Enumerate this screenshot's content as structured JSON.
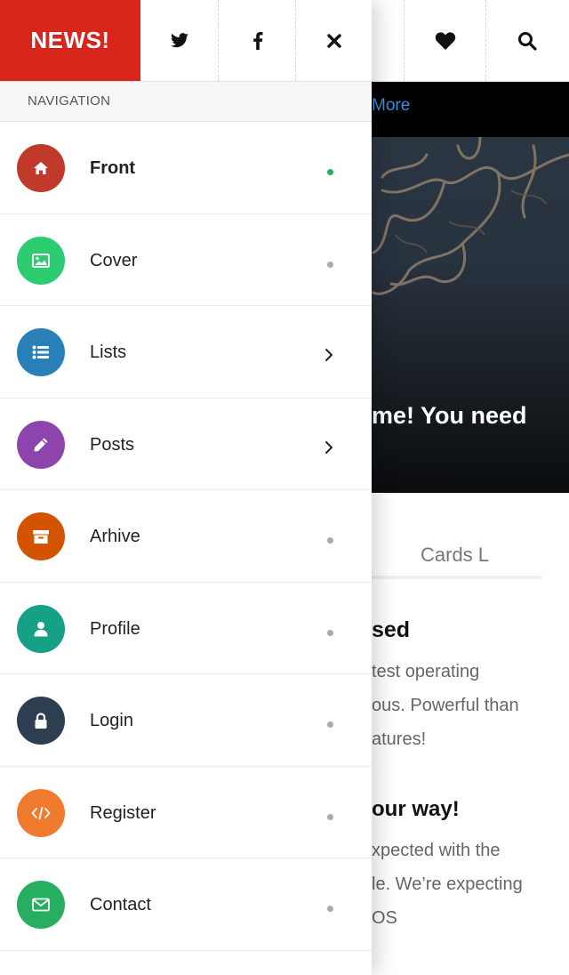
{
  "colors": {
    "brand_red": "#d9261c",
    "active_dot": "#27ae60",
    "inactive_dot": "#aaaaaa",
    "link_blue": "#3b8fd6"
  },
  "drawer": {
    "brand": "NEWS!",
    "social_icons": [
      "twitter-icon",
      "facebook-icon",
      "close-icon"
    ],
    "section_caption": "NAVIGATION",
    "items": [
      {
        "label": "Front",
        "icon": "home-icon",
        "color": "#c0392b",
        "indicator": "dot-active"
      },
      {
        "label": "Cover",
        "icon": "image-icon",
        "color": "#2ecc71",
        "indicator": "dot"
      },
      {
        "label": "Lists",
        "icon": "list-icon",
        "color": "#2980b9",
        "indicator": "chevron"
      },
      {
        "label": "Posts",
        "icon": "pencil-icon",
        "color": "#8e44ad",
        "indicator": "chevron"
      },
      {
        "label": "Arhive",
        "icon": "archive-icon",
        "color": "#d35400",
        "indicator": "dot"
      },
      {
        "label": "Profile",
        "icon": "user-icon",
        "color": "#16a085",
        "indicator": "dot"
      },
      {
        "label": "Login",
        "icon": "lock-icon",
        "color": "#2c3e50",
        "indicator": "dot"
      },
      {
        "label": "Register",
        "icon": "code-icon",
        "color": "#f07b2e",
        "indicator": "dot"
      },
      {
        "label": "Contact",
        "icon": "envelope-icon",
        "color": "#27ae60",
        "indicator": "dot"
      }
    ]
  },
  "background": {
    "header_icons": [
      "heart-icon",
      "search-icon"
    ],
    "bar_link": "More",
    "hero_title": "me! You need",
    "tab_label": "Cards L",
    "heading_1": "sed",
    "para_1_lines": [
      "test operating",
      "ous. Powerful than",
      "atures!"
    ],
    "heading_2": "our way!",
    "para_2_lines": [
      "xpected with the",
      "le. We’re expecting",
      "OS"
    ]
  }
}
